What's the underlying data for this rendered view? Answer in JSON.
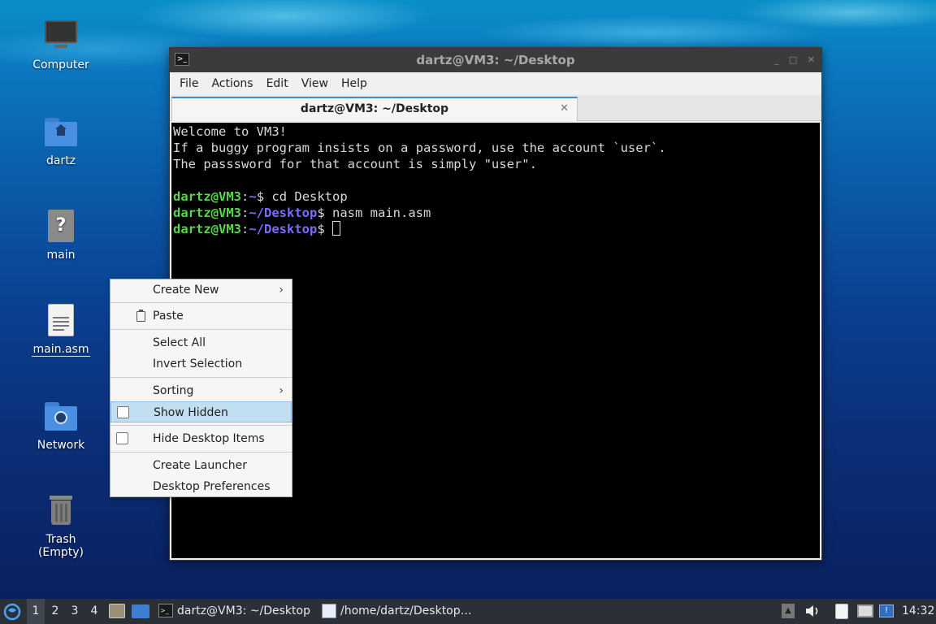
{
  "desktop": {
    "icons": [
      {
        "label": "Computer",
        "icon": "computer-icon"
      },
      {
        "label": "dartz",
        "icon": "home-folder-icon"
      },
      {
        "label": "main",
        "icon": "unknown-file-icon"
      },
      {
        "label": "main.asm",
        "icon": "text-file-icon"
      },
      {
        "label": "Network",
        "icon": "network-folder-icon"
      },
      {
        "label": "Trash (Empty)",
        "icon": "trash-icon"
      }
    ]
  },
  "terminal": {
    "window_title": "dartz@VM3: ~/Desktop",
    "menu": [
      "File",
      "Actions",
      "Edit",
      "View",
      "Help"
    ],
    "tab_title": "dartz@VM3: ~/Desktop",
    "lines": [
      "Welcome to VM3!",
      "If a buggy program insists on a password, use the account `user`.",
      "The passsword for that account is simply \"user\"."
    ],
    "prompt_user": "dartz@VM3",
    "prompt_sep": ":",
    "home_dir": "~",
    "desktop_dir": "~/Desktop",
    "prompt_end": "$",
    "cmd1": " cd Desktop",
    "cmd2": " nasm main.asm",
    "cmd3": " "
  },
  "context_menu": {
    "create_new": "Create New",
    "paste": "Paste",
    "select_all": "Select All",
    "invert_selection": "Invert Selection",
    "sorting": "Sorting",
    "show_hidden": "Show Hidden",
    "show_hidden_checked": false,
    "hide_desktop_items": "Hide Desktop Items",
    "hide_desktop_items_checked": false,
    "create_launcher": "Create Launcher",
    "desktop_preferences": "Desktop Preferences",
    "submenu_arrow": "›"
  },
  "taskbar": {
    "workspaces": [
      "1",
      "2",
      "3",
      "4"
    ],
    "active_workspace": "1",
    "tasks": [
      {
        "label": "dartz@VM3: ~/Desktop",
        "icon": "terminal-icon"
      },
      {
        "label": "/home/dartz/Desktop…",
        "icon": "text-editor-icon"
      }
    ],
    "clock": "14:32"
  },
  "colors": {
    "prompt_green": "#59d64c",
    "path_blue": "#7b6cff",
    "menu_highlight": "#c2dff2",
    "taskbar_bg": "#2b2f36"
  }
}
